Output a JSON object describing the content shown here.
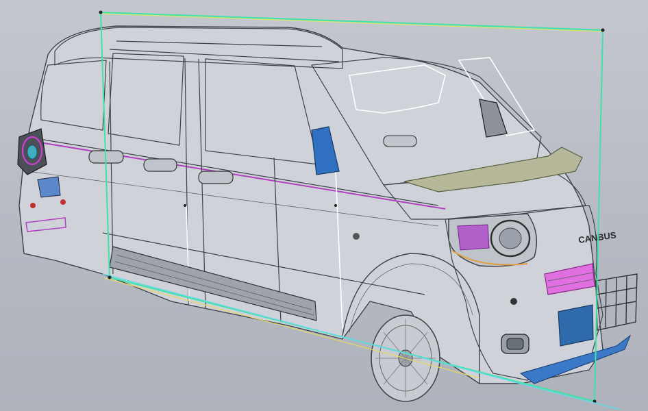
{
  "scene": {
    "badge_text": "CANBUS",
    "colors": {
      "background": "#babec6",
      "body_surface": "#cfd2d8",
      "wire_edge": "#3d424a",
      "section_plane": "#3fe3a6",
      "section_line": "#66d8e6",
      "trim_line": "#b040c0",
      "highlight_blue": "#3070c0",
      "grille_magenta": "#e060e0",
      "license_plate": "#2f6aaa"
    },
    "icons": [
      "section-plane-icon",
      "headlamp-icon",
      "wheel-icon",
      "side-mirror-icon",
      "license-plate-icon"
    ]
  }
}
